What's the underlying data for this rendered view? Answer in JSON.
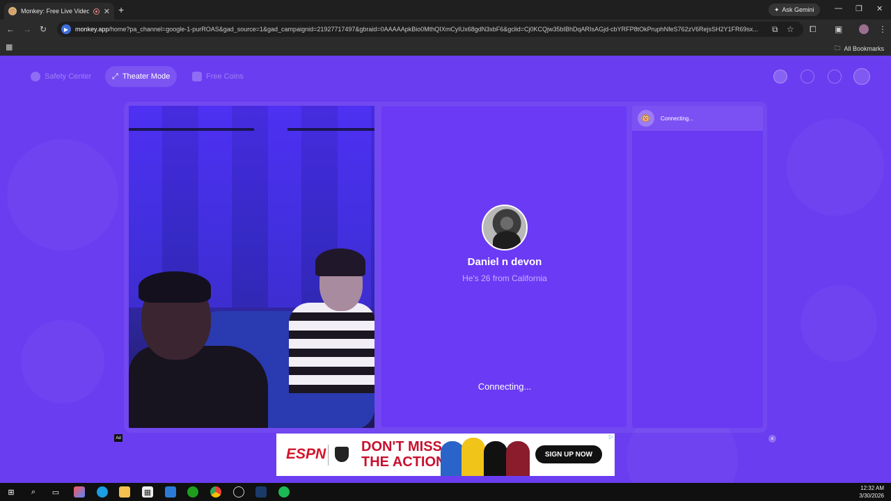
{
  "browser": {
    "tab_title": "Monkey: Free Live Video Ch",
    "new_tab": "+",
    "gemini_label": "Ask Gemini",
    "url_host": "monkey.app",
    "url_path": "/home?pa_channel=google-1-purROAS&gad_source=1&gad_campaignid=21927717497&gbraid=0AAAAApkBio0MthQIXmCyIUx68gdN3xbF6&gclid=Cj0KCQjw35bIBhDqARIsAGjd-cbYRFP8tOkPruphNfeS762zV6RejsSH2Y1FR69sx...",
    "all_bookmarks": "All Bookmarks"
  },
  "nav": {
    "safety_center": "Safety Center",
    "theater_mode": "Theater Mode",
    "free_coins": "Free Coins"
  },
  "match": {
    "name": "Daniel n devon",
    "description": "He's 26 from California",
    "status": "Connecting..."
  },
  "chat": {
    "status": "Connecting..."
  },
  "ad": {
    "label": "Ad",
    "brand": "ESPN",
    "headline_1": "DON'T MISS",
    "headline_2": "THE ACTION",
    "cta": "SIGN UP NOW",
    "close": "×"
  },
  "taskbar": {
    "time": "12:32 AM",
    "date": "3/30/2026"
  },
  "colors": {
    "page_bg": "#6a3df0",
    "accent": "#ffffff"
  }
}
